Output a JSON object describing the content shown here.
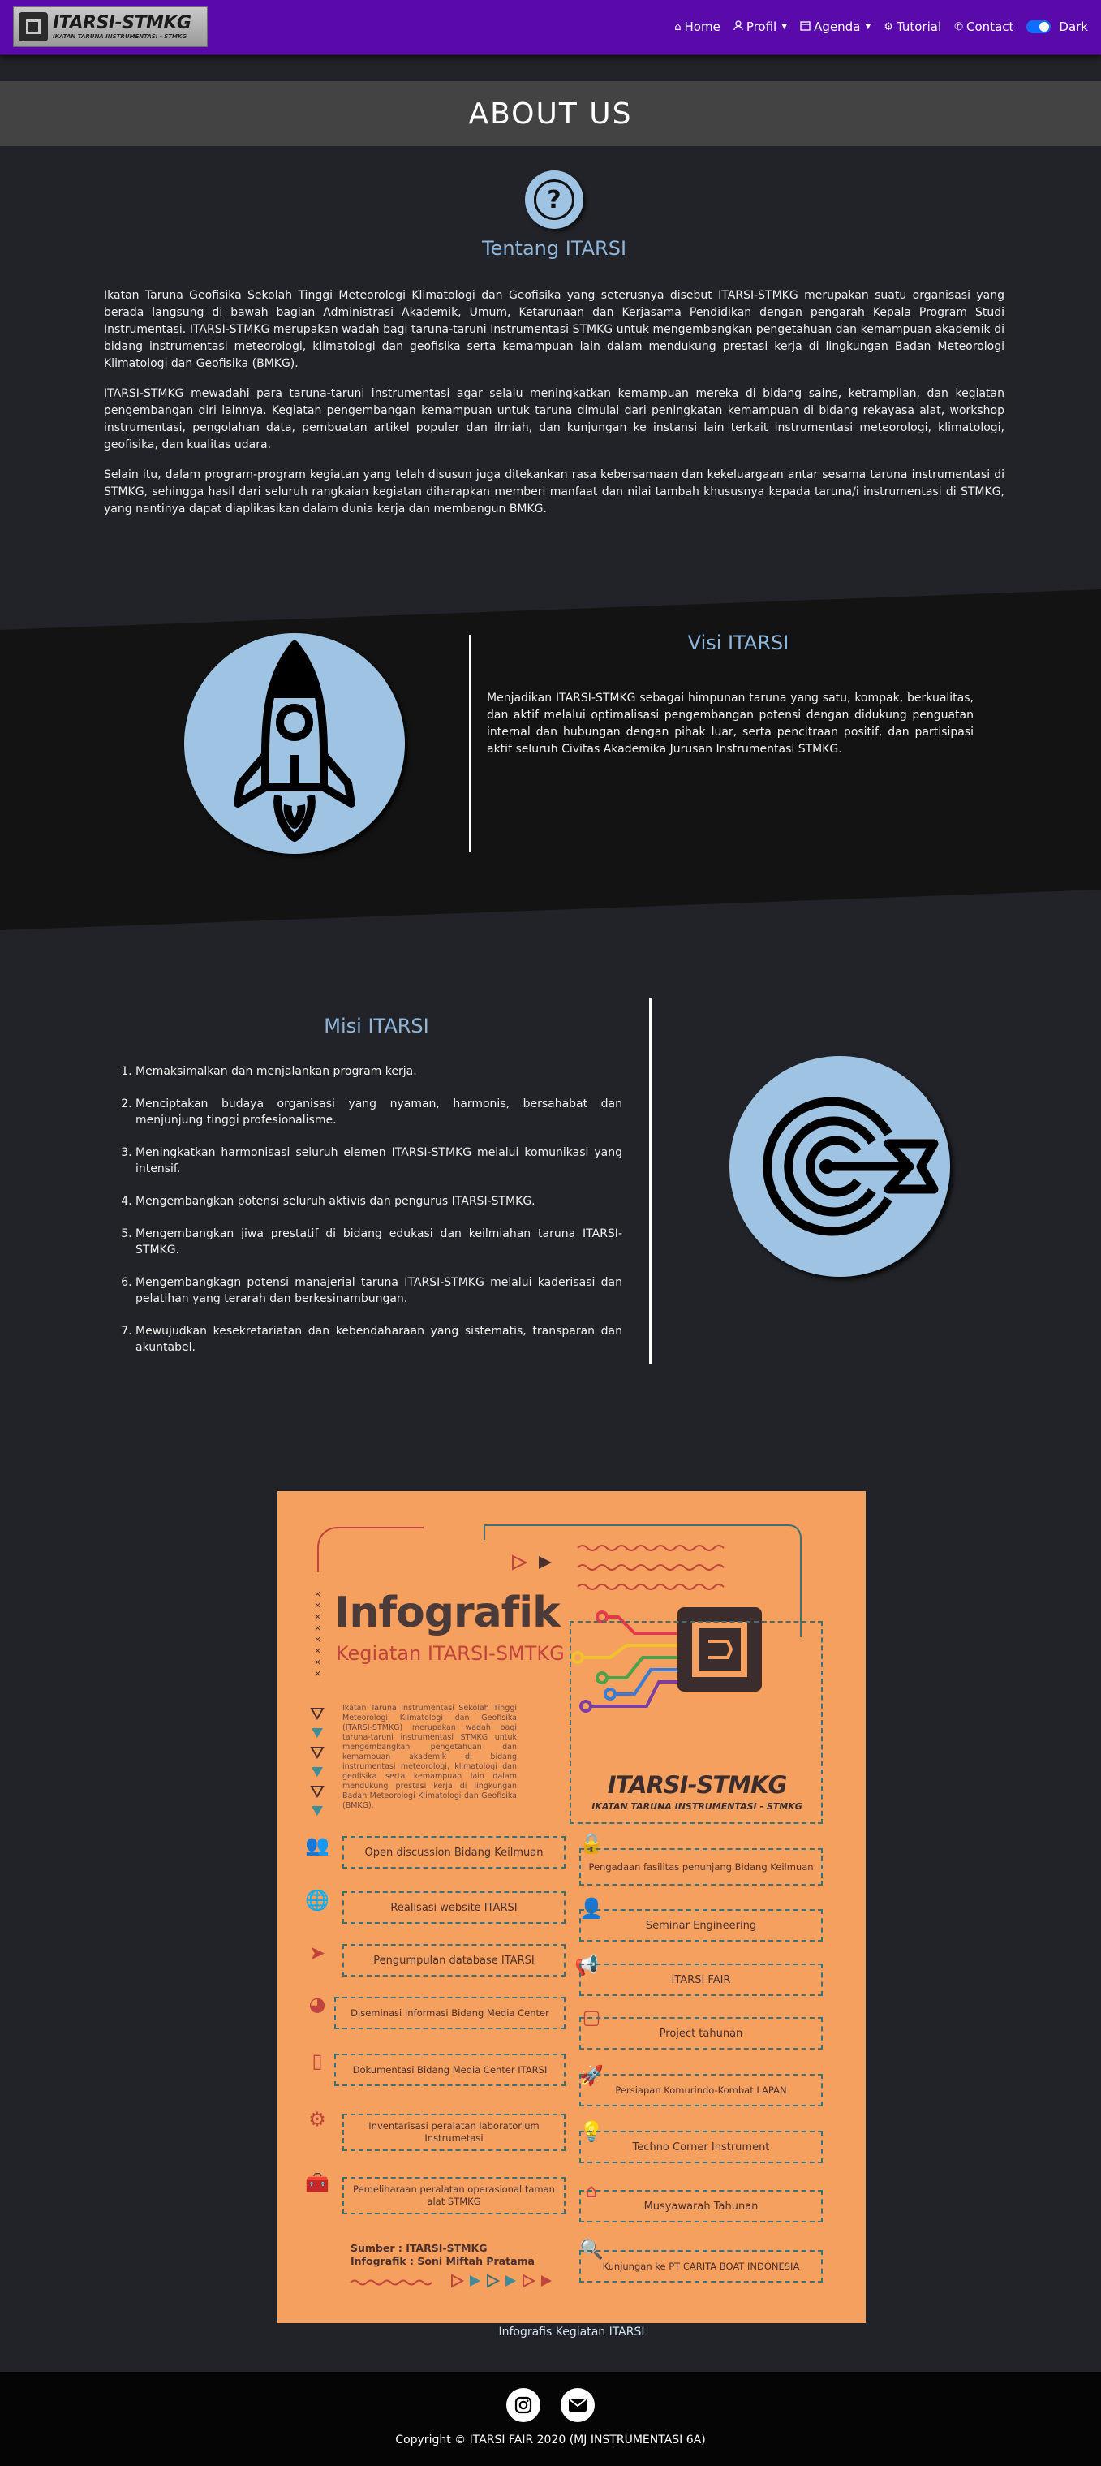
{
  "brand": {
    "title": "ITARSI-STMKG",
    "subtitle": "IKATAN TARUNA INSTRUMENTASI - STMKG"
  },
  "nav": {
    "home": "Home",
    "profil": "Profil",
    "agenda": "Agenda",
    "tutorial": "Tutorial",
    "contact": "Contact",
    "dark": "Dark"
  },
  "header": {
    "title": "ABOUT US"
  },
  "tentang": {
    "title": "Tentang ITARSI",
    "paragraphs": [
      "Ikatan Taruna Geofisika Sekolah Tinggi Meteorologi Klimatologi dan Geofisika yang seterusnya disebut ITARSI-STMKG merupakan suatu organisasi yang berada langsung di bawah bagian Administrasi Akademik, Umum, Ketarunaan dan Kerjasama Pendidikan dengan pengarah Kepala Program Studi Instrumentasi. ITARSI-STMKG merupakan wadah bagi taruna-taruni Instrumentasi STMKG untuk mengembangkan pengetahuan dan kemampuan akademik di bidang instrumentasi meteorologi, klimatologi dan geofisika serta kemampuan lain dalam mendukung prestasi kerja di lingkungan Badan Meteorologi Klimatologi dan Geofisika (BMKG).",
      "ITARSI-STMKG mewadahi para taruna-taruni instrumentasi agar selalu meningkatkan kemampuan mereka di bidang sains, ketrampilan, dan kegiatan pengembangan diri lainnya. Kegiatan pengembangan kemampuan untuk taruna dimulai dari peningkatan kemampuan di bidang rekayasa alat, workshop instrumentasi, pengolahan data, pembuatan artikel populer dan ilmiah, dan kunjungan ke instansi lain terkait instrumentasi meteorologi, klimatologi, geofisika, dan kualitas udara.",
      "Selain itu, dalam program-program kegiatan yang telah disusun juga ditekankan rasa kebersamaan dan kekeluargaan antar sesama taruna instrumentasi di STMKG, sehingga hasil dari seluruh rangkaian kegiatan diharapkan memberi manfaat dan nilai tambah khususnya kepada taruna/i instrumentasi di STMKG, yang nantinya dapat diaplikasikan dalam dunia kerja dan membangun BMKG."
    ]
  },
  "visi": {
    "title": "Visi ITARSI",
    "text": "Menjadikan ITARSI-STMKG sebagai himpunan taruna yang satu, kompak, berkualitas, dan aktif melalui optimalisasi pengembangan potensi dengan didukung penguatan internal dan hubungan dengan pihak luar, serta pencitraan positif, dan partisipasi aktif seluruh Civitas Akademika Jurusan Instrumentasi STMKG."
  },
  "misi": {
    "title": "Misi ITARSI",
    "items": [
      "Memaksimalkan dan menjalankan program kerja.",
      "Menciptakan budaya organisasi yang nyaman, harmonis, bersahabat dan menjunjung tinggi profesionalisme.",
      "Meningkatkan harmonisasi seluruh elemen ITARSI-STMKG melalui komunikasi yang intensif.",
      "Mengembangkan potensi seluruh aktivis dan pengurus ITARSI-STMKG.",
      "Mengembangkan jiwa prestatif di bidang edukasi dan keilmiahan taruna ITARSI-STMKG.",
      "Mengembangkagn potensi manajerial taruna ITARSI-STMKG melalui kaderisasi dan pelatihan yang terarah dan berkesinambungan.",
      "Mewujudkan kesekretariatan dan kebendaharaan yang sistematis, transparan dan akuntabel."
    ]
  },
  "infografik": {
    "title": "Infografik",
    "subtitle": "Kegiatan ITARSI-SMTKG",
    "description": "Ikatan Taruna Instrumentasi Sekolah Tinggi Meteorologi Klimatologi dan Geofisika (ITARSI-STMKG) merupakan wadah bagi taruna-taruni instrumentasi STMKG untuk mengembangkan pengetahuan dan kemampuan akademik di bidang instrumentasi meteorologi, klimatologi dan geofisika serta kemampuan lain dalam mendukung prestasi kerja di lingkungan Badan Meteorologi Klimatologi dan Geofisika (BMKG).",
    "logo_title": "ITARSI-STMKG",
    "logo_subtitle": "IKATAN TARUNA INSTRUMENTASI - STMKG",
    "left_items": [
      "Open discussion Bidang Keilmuan",
      "Realisasi website ITARSI",
      "Pengumpulan database ITARSI",
      "Diseminasi Informasi Bidang Media Center",
      "Dokumentasi Bidang Media Center ITARSI",
      "Inventarisasi peralatan laboratorium Instrumetasi",
      "Pemeliharaan peralatan operasional taman alat STMKG"
    ],
    "right_items": [
      "Pengadaan fasilitas penunjang Bidang Keilmuan",
      "Seminar Engineering",
      "ITARSI FAIR",
      "Project tahunan",
      "Persiapan Komurindo-Kombat LAPAN",
      "Techno Corner Instrument",
      "Musyawarah Tahunan",
      "Kunjungan ke PT CARITA BOAT INDONESIA"
    ],
    "source_line1": "Sumber : ITARSI-STMKG",
    "source_line2": "Infografik : Soni Miftah Pratama",
    "caption": "Infografis Kegiatan ITARSI"
  },
  "footer": {
    "copyright": "Copyright © ITARSI FAIR 2020 (MJ INSTRUMENTASI 6A)"
  },
  "colors": {
    "navbar": "#5a0aab",
    "accent_blue": "#8fb6dc",
    "icon_circle": "#9fc3e3",
    "infographic_bg": "#f5a05e"
  }
}
